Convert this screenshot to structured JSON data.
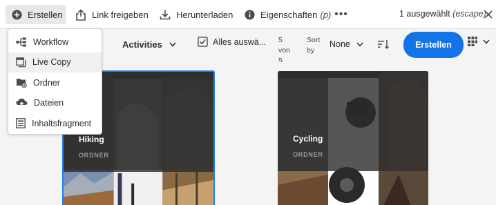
{
  "actionbar": {
    "create_label": "Erstellen",
    "link_label": "Link freigeben",
    "download_label": "Herunterladen",
    "properties_label": "Eigenschaften",
    "properties_shortcut": "(p)",
    "more_label": "•••",
    "selected_text": "1 ausgewählt",
    "selected_escape": "(escape)"
  },
  "toolbar": {
    "activities_label": "Activities",
    "select_all_label": "Alles auswä...",
    "count_line1": "5 von",
    "count_line2": "5",
    "sort_line1": "Sort",
    "sort_line2": "by",
    "sort_value": "None",
    "create_button_label": "Erstellen"
  },
  "menu": {
    "items": [
      {
        "label": "Workflow",
        "icon": "workflow-icon"
      },
      {
        "label": "Live Copy",
        "icon": "live-copy-icon"
      },
      {
        "label": "Ordner",
        "icon": "folder-add-icon"
      },
      {
        "label": "Dateien",
        "icon": "upload-cloud-icon"
      },
      {
        "label": "Inhaltsfragment",
        "icon": "content-fragment-icon"
      }
    ],
    "hovered_index": 1
  },
  "cards": [
    {
      "title": "Hiking",
      "type": "ORDNER",
      "selected": true
    },
    {
      "title": "Cycling",
      "type": "ORDNER",
      "selected": false
    }
  ],
  "colors": {
    "accent": "#1473e6",
    "selection_border": "#2680eb",
    "toolbar_bg": "#f4f4f4"
  }
}
